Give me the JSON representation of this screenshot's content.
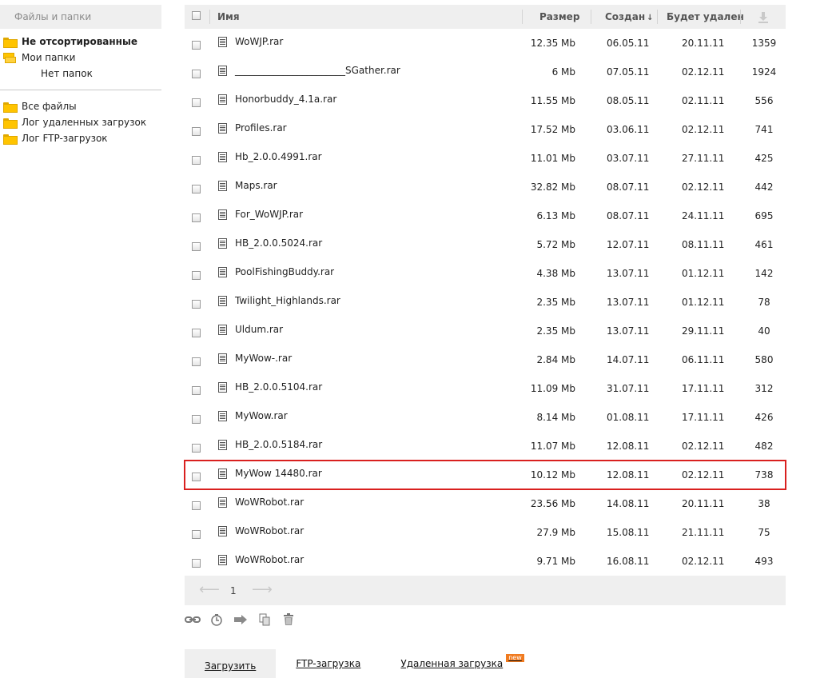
{
  "sidebar": {
    "header": "Файлы и папки",
    "items_top": [
      {
        "label": "Не отсортированные",
        "icon": "folder-icon",
        "bold": true
      },
      {
        "label": "Мои папки",
        "icon": "folders-icon"
      }
    ],
    "no_folders": "Нет папок",
    "items_bottom": [
      {
        "label": "Все файлы",
        "icon": "folder-icon"
      },
      {
        "label": "Лог удаленных загрузок",
        "icon": "folder-icon"
      },
      {
        "label": "Лог FTP-загрузок",
        "icon": "folder-icon"
      }
    ]
  },
  "table": {
    "columns": {
      "name": "Имя",
      "size": "Размер",
      "created": "Создан",
      "created_sort": "↓",
      "delete": "Будет удален",
      "downloads_icon": "download-icon"
    },
    "rows": [
      {
        "name": "WoWJP.rar",
        "size": "12.35 Mb",
        "created": "06.05.11",
        "delete": "20.11.11",
        "downloads": "1359"
      },
      {
        "name": "_______________________SGather.rar",
        "size": "6 Mb",
        "created": "07.05.11",
        "delete": "02.12.11",
        "downloads": "1924"
      },
      {
        "name": "Honorbuddy_4.1a.rar",
        "size": "11.55 Mb",
        "created": "08.05.11",
        "delete": "02.11.11",
        "downloads": "556"
      },
      {
        "name": "Profiles.rar",
        "size": "17.52 Mb",
        "created": "03.06.11",
        "delete": "02.12.11",
        "downloads": "741"
      },
      {
        "name": "Hb_2.0.0.4991.rar",
        "size": "11.01 Mb",
        "created": "03.07.11",
        "delete": "27.11.11",
        "downloads": "425"
      },
      {
        "name": "Maps.rar",
        "size": "32.82 Mb",
        "created": "08.07.11",
        "delete": "02.12.11",
        "downloads": "442"
      },
      {
        "name": "For_WoWJP.rar",
        "size": "6.13 Mb",
        "created": "08.07.11",
        "delete": "24.11.11",
        "downloads": "695"
      },
      {
        "name": "HB_2.0.0.5024.rar",
        "size": "5.72 Mb",
        "created": "12.07.11",
        "delete": "08.11.11",
        "downloads": "461"
      },
      {
        "name": "PoolFishingBuddy.rar",
        "size": "4.38 Mb",
        "created": "13.07.11",
        "delete": "01.12.11",
        "downloads": "142"
      },
      {
        "name": "Twilight_Highlands.rar",
        "size": "2.35 Mb",
        "created": "13.07.11",
        "delete": "01.12.11",
        "downloads": "78"
      },
      {
        "name": "Uldum.rar",
        "size": "2.35 Mb",
        "created": "13.07.11",
        "delete": "29.11.11",
        "downloads": "40"
      },
      {
        "name": "MyWow-.rar",
        "size": "2.84 Mb",
        "created": "14.07.11",
        "delete": "06.11.11",
        "downloads": "580"
      },
      {
        "name": "HB_2.0.0.5104.rar",
        "size": "11.09 Mb",
        "created": "31.07.11",
        "delete": "17.11.11",
        "downloads": "312"
      },
      {
        "name": "MyWow.rar",
        "size": "8.14 Mb",
        "created": "01.08.11",
        "delete": "17.11.11",
        "downloads": "426"
      },
      {
        "name": "HB_2.0.0.5184.rar",
        "size": "11.07 Mb",
        "created": "12.08.11",
        "delete": "02.12.11",
        "downloads": "482"
      },
      {
        "name": "MyWow 14480.rar",
        "size": "10.12 Mb",
        "created": "12.08.11",
        "delete": "02.12.11",
        "downloads": "738",
        "highlighted": true
      },
      {
        "name": "WoWRobot.rar",
        "size": "23.56 Mb",
        "created": "14.08.11",
        "delete": "20.11.11",
        "downloads": "38"
      },
      {
        "name": "WoWRobot.rar",
        "size": "27.9 Mb",
        "created": "15.08.11",
        "delete": "21.11.11",
        "downloads": "75"
      },
      {
        "name": "WoWRobot.rar",
        "size": "9.71 Mb",
        "created": "16.08.11",
        "delete": "02.12.11",
        "downloads": "493"
      }
    ],
    "pager": {
      "prev": "⟵",
      "page": "1",
      "next": "⟶"
    }
  },
  "actions": [
    {
      "icon": "link-icon"
    },
    {
      "icon": "timer-icon"
    },
    {
      "icon": "move-arrow-icon"
    },
    {
      "icon": "copy-icon"
    },
    {
      "icon": "trash-icon"
    }
  ],
  "tabs": [
    {
      "label": "Загрузить",
      "active": true
    },
    {
      "label": "FTP-загрузка"
    },
    {
      "label": "Удаленная загрузка",
      "badge": "new"
    }
  ],
  "colors": {
    "highlight": "#d9201f",
    "badge": "#f07a1f",
    "folder": "#ffc400"
  }
}
